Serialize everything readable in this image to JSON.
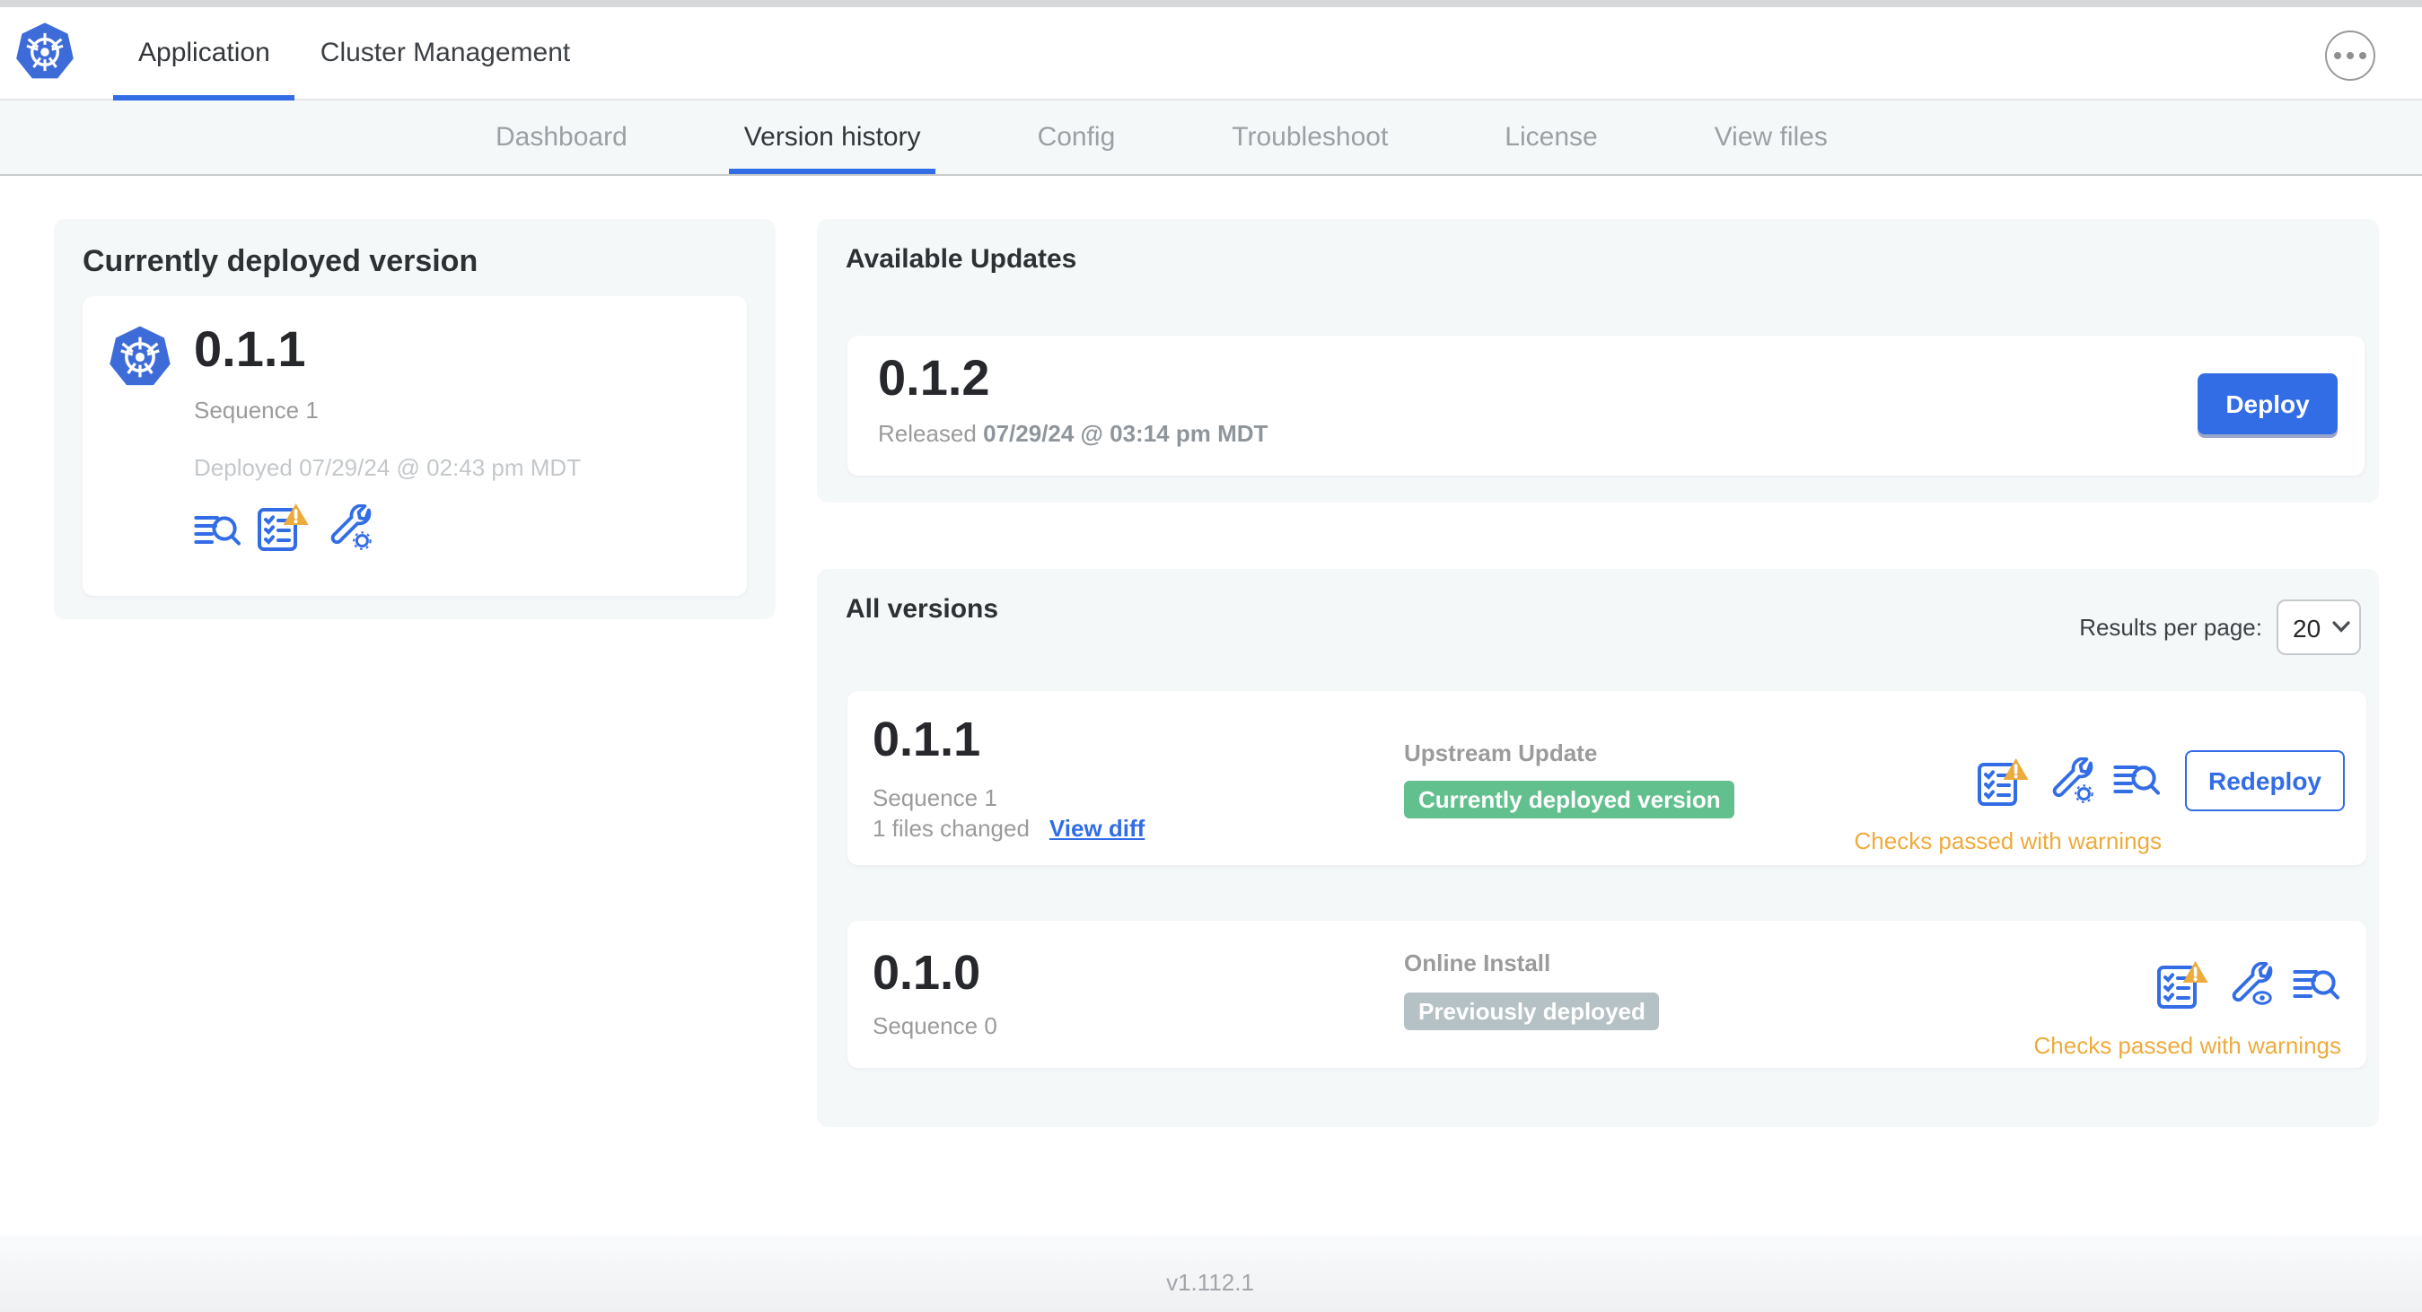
{
  "header": {
    "tabs": [
      {
        "label": "Application",
        "active": true
      },
      {
        "label": "Cluster Management",
        "active": false
      }
    ]
  },
  "nav": {
    "tabs": [
      {
        "label": "Dashboard",
        "active": false
      },
      {
        "label": "Version history",
        "active": true
      },
      {
        "label": "Config",
        "active": false
      },
      {
        "label": "Troubleshoot",
        "active": false
      },
      {
        "label": "License",
        "active": false
      },
      {
        "label": "View files",
        "active": false
      }
    ]
  },
  "current_version": {
    "section_title": "Currently deployed version",
    "version": "0.1.1",
    "sequence": "Sequence 1",
    "deployed_at": "Deployed 07/29/24 @ 02:43 pm MDT",
    "icons": [
      "logs-icon",
      "preflight-checklist-warning-icon",
      "config-wrench-icon"
    ]
  },
  "available_updates": {
    "section_title": "Available Updates",
    "version": "0.1.2",
    "released_label": "Released",
    "released_at": "07/29/24 @ 03:14 pm MDT",
    "deploy_label": "Deploy"
  },
  "all_versions": {
    "section_title": "All versions",
    "results_per_page_label": "Results per page:",
    "results_per_page_value": "20",
    "rows": [
      {
        "version": "0.1.1",
        "sequence": "Sequence 1",
        "files_changed": "1 files changed",
        "view_diff_label": "View diff",
        "source": "Upstream Update",
        "badge": "Currently deployed version",
        "action_label": "Redeploy",
        "status": "Checks passed with warnings",
        "icons": [
          "preflight-checklist-warning-icon",
          "config-wrench-gear-icon",
          "logs-icon"
        ]
      },
      {
        "version": "0.1.0",
        "sequence": "Sequence 0",
        "source": "Online Install",
        "badge": "Previously deployed",
        "status": "Checks passed with warnings",
        "icons": [
          "preflight-checklist-warning-icon",
          "config-wrench-view-icon",
          "logs-icon"
        ]
      }
    ]
  },
  "footer": {
    "app_version": "v1.112.1"
  },
  "colors": {
    "accent": "#326de6",
    "warn": "#eeab3d",
    "green": "#62c08e",
    "gray_badge": "#b5c1c4",
    "section_bg": "#f5f8f9",
    "gray": "#9b9b9b",
    "light": "#c4c8cb",
    "k8s_blue": "#3d6cd8"
  }
}
